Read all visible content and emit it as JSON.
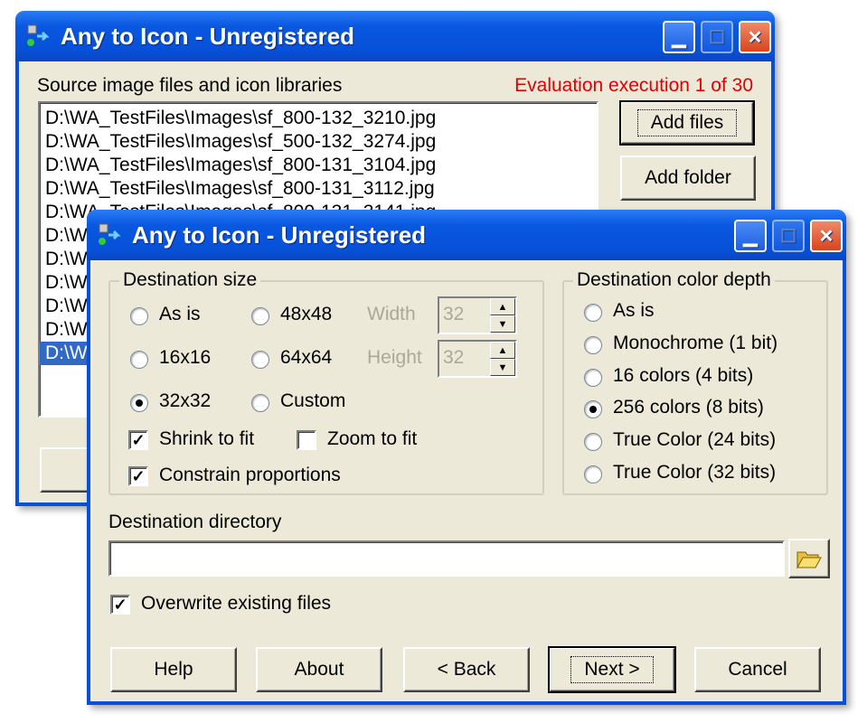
{
  "back_window": {
    "title": "Any to Icon - Unregistered",
    "source_label": "Source image files and icon libraries",
    "evaluation": "Evaluation execution 1 of 30",
    "files": [
      "D:\\WA_TestFiles\\Images\\sf_800-132_3210.jpg",
      "D:\\WA_TestFiles\\Images\\sf_500-132_3274.jpg",
      "D:\\WA_TestFiles\\Images\\sf_800-131_3104.jpg",
      "D:\\WA_TestFiles\\Images\\sf_800-131_3112.jpg",
      "D:\\WA_TestFiles\\Images\\sf_800-131_3141.jpg",
      "D:\\W",
      "D:\\W",
      "D:\\W",
      "D:\\W",
      "D:\\W",
      "D:\\W"
    ],
    "add_files": "Add files",
    "add_folder": "Add folder"
  },
  "window": {
    "title": "Any to Icon - Unregistered",
    "dest_size": {
      "label": "Destination size",
      "options": [
        "As is",
        "48x48",
        "16x16",
        "64x64",
        "32x32",
        "Custom"
      ],
      "selected": "32x32",
      "width_label": "Width",
      "width_value": "32",
      "height_label": "Height",
      "height_value": "32",
      "shrink_to_fit": "Shrink to fit",
      "shrink_checked": true,
      "zoom_to_fit": "Zoom to fit",
      "zoom_checked": false,
      "constrain": "Constrain proportions",
      "constrain_checked": true
    },
    "color_depth": {
      "label": "Destination color depth",
      "options": [
        "As is",
        "Monochrome (1 bit)",
        "16 colors (4 bits)",
        "256 colors (8 bits)",
        "True Color (24 bits)",
        "True Color (32 bits)"
      ],
      "selected": "256 colors (8 bits)"
    },
    "dest_dir": {
      "label": "Destination directory",
      "value": ""
    },
    "overwrite": {
      "label": "Overwrite existing files",
      "checked": true
    },
    "buttons": {
      "help": "Help",
      "about": "About",
      "back": "< Back",
      "next": "Next >",
      "cancel": "Cancel"
    }
  },
  "colors": {
    "titlebar": "#0a58e0",
    "evaluation": "#e00000",
    "selection": "#316ac5"
  }
}
